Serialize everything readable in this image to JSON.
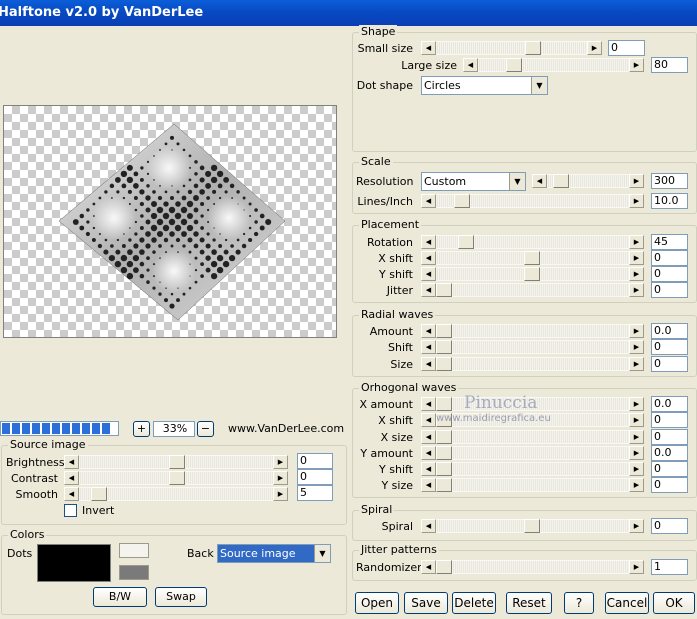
{
  "window": {
    "title": "Halftone v2.0 by VanDerLee"
  },
  "preview": {
    "zoom": "33%",
    "plus": "+",
    "minus": "−",
    "website": "www.VanDerLee.com",
    "progress_fraction": 1.0
  },
  "source_image": {
    "title": "Source image",
    "brightness": {
      "label": "Brightness",
      "value": "0"
    },
    "contrast": {
      "label": "Contrast",
      "value": "0"
    },
    "smooth": {
      "label": "Smooth",
      "value": "5"
    },
    "invert_label": "Invert",
    "invert_checked": false
  },
  "colors": {
    "title": "Colors",
    "dots_label": "Dots",
    "dots_color": "#000000",
    "back_label": "Back",
    "back_value": "Source image",
    "bw_button": "B/W",
    "swap_button": "Swap"
  },
  "shape": {
    "title": "Shape",
    "small_size": {
      "label": "Small size",
      "value": "0"
    },
    "large_size": {
      "label": "Large size",
      "value": "80"
    },
    "dot_shape": {
      "label": "Dot shape",
      "value": "Circles"
    }
  },
  "scale": {
    "title": "Scale",
    "resolution": {
      "label": "Resolution",
      "mode": "Custom",
      "value": "300"
    },
    "lines_inch": {
      "label": "Lines/Inch",
      "value": "10.0"
    }
  },
  "placement": {
    "title": "Placement",
    "rotation": {
      "label": "Rotation",
      "value": "45"
    },
    "x_shift": {
      "label": "X shift",
      "value": "0"
    },
    "y_shift": {
      "label": "Y shift",
      "value": "0"
    },
    "jitter": {
      "label": "Jitter",
      "value": "0"
    }
  },
  "radial": {
    "title": "Radial waves",
    "amount": {
      "label": "Amount",
      "value": "0.0"
    },
    "shift": {
      "label": "Shift",
      "value": "0"
    },
    "size": {
      "label": "Size",
      "value": "0"
    }
  },
  "orthogonal": {
    "title": "Orhogonal waves",
    "x_amount": {
      "label": "X amount",
      "value": "0.0"
    },
    "x_shift": {
      "label": "X shift",
      "value": "0"
    },
    "x_size": {
      "label": "X size",
      "value": "0"
    },
    "y_amount": {
      "label": "Y amount",
      "value": "0.0"
    },
    "y_shift": {
      "label": "Y shift",
      "value": "0"
    },
    "y_size": {
      "label": "Y size",
      "value": "0"
    }
  },
  "spiral": {
    "title": "Spiral",
    "spiral": {
      "label": "Spiral",
      "value": "0"
    }
  },
  "jitter_patterns": {
    "title": "Jitter patterns",
    "randomizer": {
      "label": "Randomizer",
      "value": "1"
    }
  },
  "watermark": {
    "name": "Pinuccia",
    "url": "www.maidiregrafica.eu"
  },
  "buttons": {
    "open": "Open",
    "save": "Save",
    "delete": "Delete",
    "reset": "Reset",
    "help": "?",
    "cancel": "Cancel",
    "ok": "OK"
  }
}
